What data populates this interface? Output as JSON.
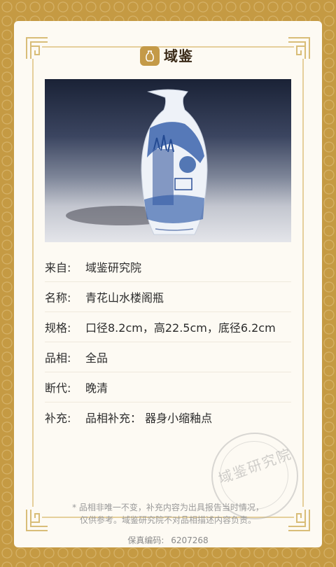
{
  "brand": {
    "name": "域鉴",
    "tagline": "",
    "accent_color": "#c49a48",
    "frame_color": "#c59a43"
  },
  "details": [
    {
      "key": "来自:",
      "value": "域鉴研究院"
    },
    {
      "key": "名称:",
      "value": "青花山水楼阁瓶"
    },
    {
      "key": "规格:",
      "value": "口径8.2cm，高22.5cm，底径6.2cm"
    },
    {
      "key": "品相:",
      "value": "全品"
    },
    {
      "key": "断代:",
      "value": "晚清"
    },
    {
      "key": "补充:",
      "value": "品相补充：  器身小缩釉点"
    }
  ],
  "note": {
    "line1": "* 品相非唯一不变，补充内容为出具报告当时情况，",
    "line2": "仅供参考。域鉴研究院不对品相描述内容负责。"
  },
  "serial": {
    "label": "保真编码:",
    "value": "6207268"
  },
  "stamp": {
    "text": "域鉴研究院"
  }
}
